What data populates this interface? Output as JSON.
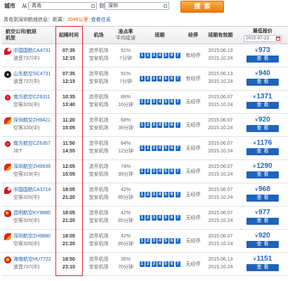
{
  "search": {
    "city_label": "城市",
    "from_label": "从",
    "from_value": "青岛",
    "to_label": "到",
    "to_value": "深圳",
    "search_button": "搜索"
  },
  "route_info": {
    "prefix": "青岛到深圳航线信息：距离：",
    "distance": "2049公里",
    "round_trip_link": "查看往返"
  },
  "table": {
    "headers": {
      "airline": "航空公司/航班",
      "aircraft": "机型",
      "times": "起降时间",
      "airport": "机场",
      "on_time": "准点率",
      "avg_delay": "平均延误",
      "schedule": "班期",
      "stops": "经停",
      "validity": "班期有效期",
      "lowest_price": "最低报价",
      "date": "2015-07-23"
    },
    "currency": "¥",
    "view_label": "查看",
    "rows": [
      {
        "airline": "中国国航",
        "flight": "CA4731",
        "aircraft": "波音737(中)",
        "logo_icon": "air-china-logo-icon",
        "depart_time": "07:35",
        "arrive_time": "12:15",
        "depart_airport": "流亭机场",
        "arrive_airport": "宝安机场",
        "on_time_rate": "91%",
        "avg_delay": "7分钟",
        "days": [
          "1",
          "2",
          "3",
          "4",
          "5",
          "6",
          "7"
        ],
        "stops": "有经停",
        "valid_from": "2015.06.13",
        "valid_to": "2015.10.24",
        "price": "973"
      },
      {
        "airline": "山东航空",
        "flight": "SC4731",
        "aircraft": "波音737(中)",
        "logo_icon": "shandong-airlines-logo-icon",
        "depart_time": "07:35",
        "arrive_time": "12:15",
        "depart_airport": "流亭机场",
        "arrive_airport": "宝安机场",
        "on_time_rate": "91%",
        "avg_delay": "7分钟",
        "days": [
          "1",
          "2",
          "3",
          "4",
          "5",
          "6",
          "7"
        ],
        "stops": "有经停",
        "valid_from": "2015.06.13",
        "valid_to": "2015.10.24",
        "price": "940"
      },
      {
        "airline": "南方航空",
        "flight": "CZ6311",
        "aircraft": "空客320(中)",
        "logo_icon": "china-southern-logo-icon",
        "depart_time": "10:35",
        "arrive_time": "13:40",
        "depart_airport": "流亭机场",
        "arrive_airport": "宝安机场",
        "on_time_rate": "88%",
        "avg_delay": "16分钟",
        "days": [
          "1",
          "2",
          "3",
          "4",
          "5",
          "6",
          "7"
        ],
        "stops": "无经停",
        "valid_from": "2015.06.07",
        "valid_to": "2015.10.24",
        "price": "1371"
      },
      {
        "airline": "深圳航空",
        "flight": "ZH9421",
        "aircraft": "空客320(中)",
        "logo_icon": "shenzhen-airlines-logo-icon",
        "depart_time": "11:20",
        "arrive_time": "15:05",
        "depart_airport": "流亭机场",
        "arrive_airport": "宝安机场",
        "on_time_rate": "68%",
        "avg_delay": "39分钟",
        "days": [
          "1",
          "2",
          "3",
          "4",
          "5",
          "6",
          "7"
        ],
        "stops": "无经停",
        "valid_from": "2015.06.07",
        "valid_to": "2015.10.24",
        "price": "920"
      },
      {
        "airline": "南方航空",
        "flight": "CZ6357",
        "aircraft": "JET",
        "logo_icon": "china-southern-logo-icon",
        "depart_time": "11:50",
        "arrive_time": "14:55",
        "depart_airport": "流亭机场",
        "arrive_airport": "宝安机场",
        "on_time_rate": "84%",
        "avg_delay": "12分钟",
        "days": [
          "1",
          "2",
          "3",
          "4",
          "5",
          "6",
          "7"
        ],
        "stops": "无经停",
        "valid_from": "2015.06.07",
        "valid_to": "2015.10.24",
        "price": "1176"
      },
      {
        "airline": "深圳航空",
        "flight": "ZH9939",
        "aircraft": "空客319(中)",
        "logo_icon": "shenzhen-airlines-logo-icon",
        "depart_time": "12:05",
        "arrive_time": "15:05",
        "depart_airport": "流亭机场",
        "arrive_airport": "宝安机场",
        "on_time_rate": "74%",
        "avg_delay": "39分钟",
        "days": [
          "1",
          "2",
          "3",
          "4",
          "5",
          "6",
          "7"
        ],
        "stops": "无经停",
        "valid_from": "2015.06.07",
        "valid_to": "2015.10.24",
        "price": "1290"
      },
      {
        "airline": "中国国航",
        "flight": "CA3714",
        "aircraft": "空客320(中)",
        "logo_icon": "air-china-logo-icon",
        "depart_time": "18:05",
        "arrive_time": "21:20",
        "depart_airport": "流亭机场",
        "arrive_airport": "宝安机场",
        "on_time_rate": "42%",
        "avg_delay": "85分钟",
        "days": [
          "1",
          "2",
          "3",
          "4",
          "5",
          "6",
          "7"
        ],
        "stops": "无经停",
        "valid_from": "2015.06.07",
        "valid_to": "2015.10.24",
        "price": "968"
      },
      {
        "airline": "昆明航空",
        "flight": "KY9880",
        "aircraft": "空客320(中)",
        "logo_icon": "kunming-airlines-logo-icon",
        "depart_time": "18:05",
        "arrive_time": "21:20",
        "depart_airport": "流亭机场",
        "arrive_airport": "宝安机场",
        "on_time_rate": "42%",
        "avg_delay": "85分钟",
        "days": [
          "1",
          "2",
          "3",
          "4",
          "5",
          "6",
          "7"
        ],
        "stops": "无经停",
        "valid_from": "2015.06.07",
        "valid_to": "2015.10.24",
        "price": "977"
      },
      {
        "airline": "深圳航空",
        "flight": "ZH9880",
        "aircraft": "空客320(中)",
        "logo_icon": "shenzhen-airlines-logo-icon",
        "depart_time": "18:05",
        "arrive_time": "21:20",
        "depart_airport": "流亭机场",
        "arrive_airport": "宝安机场",
        "on_time_rate": "42%",
        "avg_delay": "85分钟",
        "days": [
          "1",
          "2",
          "3",
          "4",
          "5",
          "6",
          "7"
        ],
        "stops": "无经停",
        "valid_from": "2015.06.07",
        "valid_to": "2015.10.24",
        "price": "920"
      },
      {
        "airline": "海南航空",
        "flight": "HU7722",
        "aircraft": "波音737(中)",
        "logo_icon": "hainan-airlines-logo-icon",
        "depart_time": "18:50",
        "arrive_time": "23:10",
        "depart_airport": "流亭机场",
        "arrive_airport": "宝安机场",
        "on_time_rate": "35%",
        "avg_delay": "70分钟",
        "days": [
          "1",
          "2",
          "3",
          "4",
          "5",
          "6",
          "7"
        ],
        "stops": "无经停",
        "valid_from": "2015.06.13",
        "valid_to": "2015.10.24",
        "price": "1151"
      }
    ]
  },
  "icons": {
    "city_picker": "city-picker-icon",
    "calendar": "calendar-icon"
  },
  "colors": {
    "search_button": "#f39117",
    "link_blue": "#2060b0",
    "price_blue": "#2366c2",
    "schedule_day_blue": "#1d6cc6",
    "distance_orange": "#f25a00",
    "highlight_red": "#e5232b"
  }
}
